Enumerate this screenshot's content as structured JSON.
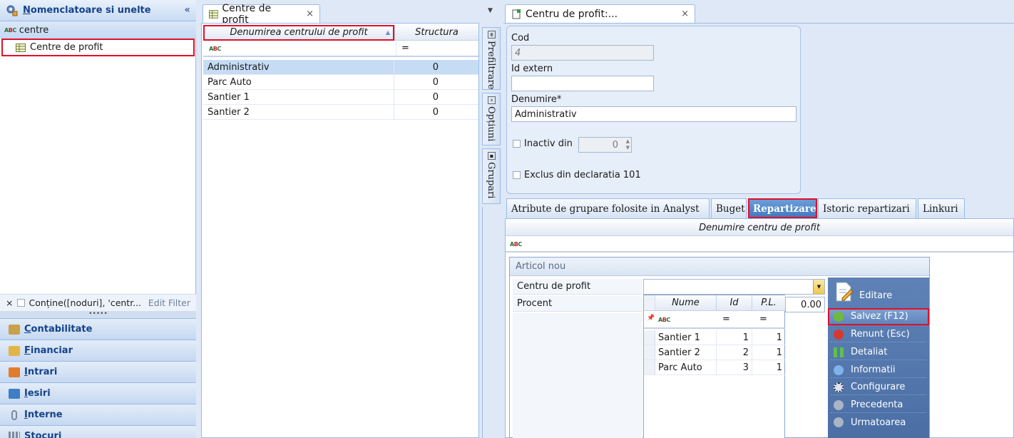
{
  "left_panel": {
    "title_first": "N",
    "title_rest": "omenclatoare si unelte",
    "collapse": "«",
    "tree_root": "centre",
    "tree_child": "Centre de profit",
    "filter_text": "Conține([noduri], 'centr...",
    "filter_close": "×",
    "edit_filter": "Edit Filter",
    "nav": [
      {
        "first": "C",
        "rest": "ontabilitate",
        "icon": "scales-icon"
      },
      {
        "first": "F",
        "rest": "inanciar",
        "icon": "money-icon"
      },
      {
        "first": "I",
        "rest": "ntrari",
        "icon": "truck-in-icon"
      },
      {
        "first": "I",
        "rest": "esiri",
        "icon": "truck-out-icon"
      },
      {
        "first": "I",
        "rest": "nterne",
        "icon": "paperclip-icon"
      },
      {
        "first": "S",
        "rest": "tocuri",
        "icon": "grid-icon"
      }
    ]
  },
  "list_panel": {
    "tab_label": "Centre de profit",
    "tab_close": "×",
    "col_name": "Denumirea centrului de profit",
    "col_structure": "Structura",
    "filter_eq": "=",
    "rows": [
      {
        "name": "Administrativ",
        "structure": "0"
      },
      {
        "name": "Parc Auto",
        "structure": "0"
      },
      {
        "name": "Santier 1",
        "structure": "0"
      },
      {
        "name": "Santier 2",
        "structure": "0"
      }
    ],
    "dropdown_arrow": "▼",
    "side_tabs": [
      "Prefiltrare",
      "Opțiuni",
      "Grupari"
    ]
  },
  "detail": {
    "tab_label": "Centru de profit:...",
    "tab_close": "×",
    "cod_label": "Cod",
    "cod_value": "4",
    "id_label": "Id extern",
    "id_value": "",
    "den_label": "Denumire*",
    "den_value": "Administrativ",
    "inactiv_label": "Inactiv din",
    "inactiv_value": "0",
    "exclus_label": "Exclus din declaratia 101",
    "subtabs": [
      "Atribute de grupare folosite in Analyst",
      "Buget",
      "Repartizare",
      "Istoric repartizari",
      "Linkuri"
    ],
    "grid_col": "Denumire centru de profit"
  },
  "popup": {
    "title": "Articol nou",
    "label_centru": "Centru de profit",
    "label_procent": "Procent",
    "procent_value": "0.00",
    "dd_cols": [
      "Nume",
      "Id",
      "P.L."
    ],
    "dd_eq": "=",
    "dd_rows": [
      {
        "name": "Santier 1",
        "id": "1",
        "pl": "1"
      },
      {
        "name": "Santier 2",
        "id": "2",
        "pl": "1"
      },
      {
        "name": "Parc Auto",
        "id": "3",
        "pl": "1"
      }
    ],
    "menu": {
      "edit": "Editare",
      "items": [
        "Salvez (F12)",
        "Renunt (Esc)",
        "Detaliat",
        "Informatii",
        "Configurare",
        "Precedenta",
        "Urmatoarea"
      ]
    }
  },
  "colors": {
    "accent": "#15428b",
    "highlight": "#e0102a",
    "selected_row": "#c6dcf5"
  }
}
